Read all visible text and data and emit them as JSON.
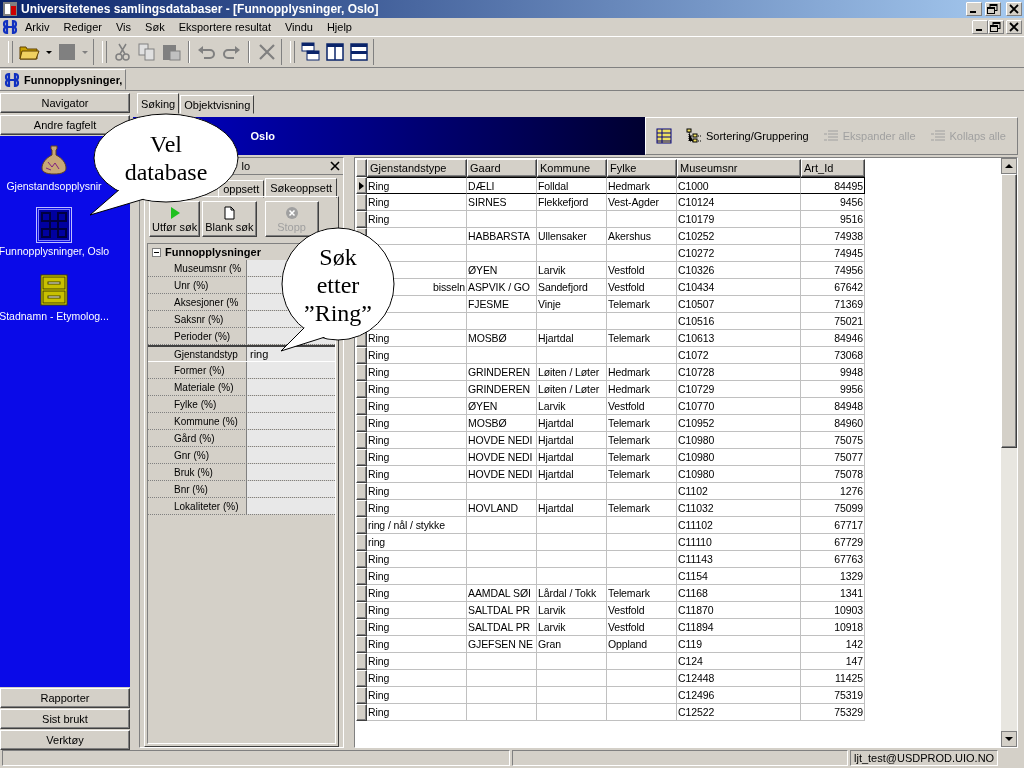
{
  "window": {
    "title": "Universitetenes samlingsdatabaser - [Funnopplysninger, Oslo]"
  },
  "menu": [
    "Arkiv",
    "Rediger",
    "Vis",
    "Søk",
    "Eksportere resultat",
    "Vindu",
    "Hjelp"
  ],
  "document_tab": {
    "label": "Funnopplysninger,"
  },
  "navigator": {
    "top_buttons": [
      "Navigator",
      "Andre fagfelt"
    ],
    "items": [
      {
        "label": "Gjenstandsopplysnir",
        "kind": "vase",
        "selected": false
      },
      {
        "label": "Funnopplysninger, Oslo",
        "kind": "pattern",
        "selected": true
      },
      {
        "label": "Stadnamn - Etymolog...",
        "kind": "cabinet",
        "selected": false
      }
    ],
    "bottom_buttons": [
      "Rapporter",
      "Sist brukt",
      "Verktøy"
    ]
  },
  "view_tabs": [
    {
      "label": "Søking",
      "selected": true
    },
    {
      "label": "Objektvisning",
      "selected": false
    }
  ],
  "header": {
    "title": "Oslo"
  },
  "result_toolbar": [
    {
      "kind": "grid",
      "disabled": false
    },
    {
      "kind": "sort",
      "label": "Sortering/Gruppering",
      "disabled": false
    },
    {
      "kind": "expand",
      "label": "Ekspander alle",
      "disabled": true
    },
    {
      "kind": "collapse",
      "label": "Kollaps alle",
      "disabled": true
    }
  ],
  "search_panel": {
    "title": "lo",
    "tabs": [
      {
        "label": "oppsett",
        "selected": false
      },
      {
        "label": "Søkeoppsett",
        "selected": true
      }
    ],
    "buttons": [
      {
        "kind": "run",
        "label": "Utfør søk",
        "disabled": false
      },
      {
        "kind": "blank",
        "label": "Blank søk",
        "disabled": false
      },
      {
        "kind": "stop",
        "label": "Stopp",
        "disabled": true
      }
    ],
    "group": {
      "label": "Funnopplysninger",
      "expanded": true,
      "fields": [
        {
          "label": "Museumsnr (%",
          "selected": false
        },
        {
          "label": "Unr (%)",
          "selected": false
        },
        {
          "label": "Aksesjoner (%",
          "selected": false
        },
        {
          "label": "Saksnr (%)",
          "selected": false
        },
        {
          "label": "Perioder (%)",
          "selected": false
        },
        {
          "label": "Gjenstandstyp",
          "value": "ring",
          "selected": true
        },
        {
          "label": "Former (%)",
          "selected": false
        },
        {
          "label": "Materiale (%)",
          "selected": false
        },
        {
          "label": "Fylke (%)",
          "selected": false
        },
        {
          "label": "Kommune (%)",
          "selected": false
        },
        {
          "label": "Gård (%)",
          "selected": false
        },
        {
          "label": "Gnr (%)",
          "selected": false
        },
        {
          "label": "Bruk (%)",
          "selected": false
        },
        {
          "label": "Bnr (%)",
          "selected": false
        },
        {
          "label": "Lokaliteter (%)",
          "selected": false
        }
      ]
    }
  },
  "grid": {
    "columns": [
      "Gjenstandstype",
      "Gaard",
      "Kommune",
      "Fylke",
      "Museumsnr",
      "Art_Id"
    ],
    "rows": [
      {
        "selected": true,
        "gjenstandstype": "Ring",
        "gaard": "DÆLI",
        "kommune": "Folldal",
        "fylke": "Hedmark",
        "museumsnr": "C1000",
        "art_id": "84495"
      },
      {
        "selected": false,
        "gjenstandstype": "Ring",
        "gaard": "SIRNES",
        "kommune": "Flekkefjord",
        "fylke": "Vest-Agder",
        "museumsnr": "C10124",
        "art_id": "9456"
      },
      {
        "selected": false,
        "gjenstandstype": "Ring",
        "museumsnr": "C10179",
        "art_id": "9516"
      },
      {
        "selected": false,
        "gaard": "HABBARSTA",
        "kommune": "Ullensaker",
        "fylke": "Akershus",
        "museumsnr": "C10252",
        "art_id": "74938"
      },
      {
        "selected": false,
        "museumsnr": "C10272",
        "art_id": "74945"
      },
      {
        "selected": false,
        "gaard": "ØYEN",
        "kommune": "Larvik",
        "fylke": "Vestfold",
        "museumsnr": "C10326",
        "art_id": "74956"
      },
      {
        "selected": false,
        "gjenstandstype": "bisseln",
        "type_clipped": true,
        "gaard": "ASPVIK / GO",
        "kommune": "Sandefjord",
        "fylke": "Vestfold",
        "museumsnr": "C10434",
        "art_id": "67642"
      },
      {
        "selected": false,
        "gaard": "FJESME",
        "kommune": "Vinje",
        "fylke": "Telemark",
        "museumsnr": "C10507",
        "art_id": "71369"
      },
      {
        "selected": false,
        "museumsnr": "C10516",
        "art_id": "75021"
      },
      {
        "selected": false,
        "gjenstandstype": "Ring",
        "gaard": "MOSBØ",
        "kommune": "Hjartdal",
        "fylke": "Telemark",
        "museumsnr": "C10613",
        "art_id": "84946"
      },
      {
        "selected": false,
        "gjenstandstype": "Ring",
        "museumsnr": "C1072",
        "art_id": "73068"
      },
      {
        "selected": false,
        "gjenstandstype": "Ring",
        "gaard": "GRINDEREN",
        "kommune": "Løiten / Løter",
        "fylke": "Hedmark",
        "museumsnr": "C10728",
        "art_id": "9948"
      },
      {
        "selected": false,
        "gjenstandstype": "Ring",
        "gaard": "GRINDEREN",
        "kommune": "Løiten / Løter",
        "fylke": "Hedmark",
        "museumsnr": "C10729",
        "art_id": "9956"
      },
      {
        "selected": false,
        "gjenstandstype": "Ring",
        "gaard": "ØYEN",
        "kommune": "Larvik",
        "fylke": "Vestfold",
        "museumsnr": "C10770",
        "art_id": "84948"
      },
      {
        "selected": false,
        "gjenstandstype": "Ring",
        "gaard": "MOSBØ",
        "kommune": "Hjartdal",
        "fylke": "Telemark",
        "museumsnr": "C10952",
        "art_id": "84960"
      },
      {
        "selected": false,
        "gjenstandstype": "Ring",
        "gaard": "HOVDE NEDI",
        "kommune": "Hjartdal",
        "fylke": "Telemark",
        "museumsnr": "C10980",
        "art_id": "75075"
      },
      {
        "selected": false,
        "gjenstandstype": "Ring",
        "gaard": "HOVDE NEDI",
        "kommune": "Hjartdal",
        "fylke": "Telemark",
        "museumsnr": "C10980",
        "art_id": "75077"
      },
      {
        "selected": false,
        "gjenstandstype": "Ring",
        "gaard": "HOVDE NEDI",
        "kommune": "Hjartdal",
        "fylke": "Telemark",
        "museumsnr": "C10980",
        "art_id": "75078"
      },
      {
        "selected": false,
        "gjenstandstype": "Ring",
        "museumsnr": "C1102",
        "art_id": "1276"
      },
      {
        "selected": false,
        "gjenstandstype": "Ring",
        "gaard": "HOVLAND",
        "kommune": "Hjartdal",
        "fylke": "Telemark",
        "museumsnr": "C11032",
        "art_id": "75099"
      },
      {
        "selected": false,
        "gjenstandstype": "ring / nål / stykke",
        "museumsnr": "C11102",
        "art_id": "67717"
      },
      {
        "selected": false,
        "gjenstandstype": "ring",
        "museumsnr": "C11110",
        "art_id": "67729"
      },
      {
        "selected": false,
        "gjenstandstype": "Ring",
        "museumsnr": "C11143",
        "art_id": "67763"
      },
      {
        "selected": false,
        "gjenstandstype": "Ring",
        "museumsnr": "C1154",
        "art_id": "1329"
      },
      {
        "selected": false,
        "gjenstandstype": "Ring",
        "gaard": "AAMDAL SØI",
        "kommune": "Lårdal / Tokk",
        "fylke": "Telemark",
        "museumsnr": "C1168",
        "art_id": "1341"
      },
      {
        "selected": false,
        "gjenstandstype": "Ring",
        "gaard": "SALTDAL PR",
        "kommune": "Larvik",
        "fylke": "Vestfold",
        "museumsnr": "C11870",
        "art_id": "10903"
      },
      {
        "selected": false,
        "gjenstandstype": "Ring",
        "gaard": "SALTDAL PR",
        "kommune": "Larvik",
        "fylke": "Vestfold",
        "museumsnr": "C11894",
        "art_id": "10918"
      },
      {
        "selected": false,
        "gjenstandstype": "Ring",
        "gaard": "GJEFSEN NE",
        "kommune": "Gran",
        "fylke": "Oppland",
        "museumsnr": "C119",
        "art_id": "142"
      },
      {
        "selected": false,
        "gjenstandstype": "Ring",
        "museumsnr": "C124",
        "art_id": "147"
      },
      {
        "selected": false,
        "gjenstandstype": "Ring",
        "museumsnr": "C12448",
        "art_id": "11425"
      },
      {
        "selected": false,
        "gjenstandstype": "Ring",
        "museumsnr": "C12496",
        "art_id": "75319"
      },
      {
        "selected": false,
        "gjenstandstype": "Ring",
        "museumsnr": "C12522",
        "art_id": "75329"
      }
    ]
  },
  "status_bar": {
    "user": "ljt_test@USDPROD.UIO.NO"
  },
  "callouts": [
    {
      "text": "Vel database"
    },
    {
      "text": "Søk etter ”Ring”"
    }
  ]
}
